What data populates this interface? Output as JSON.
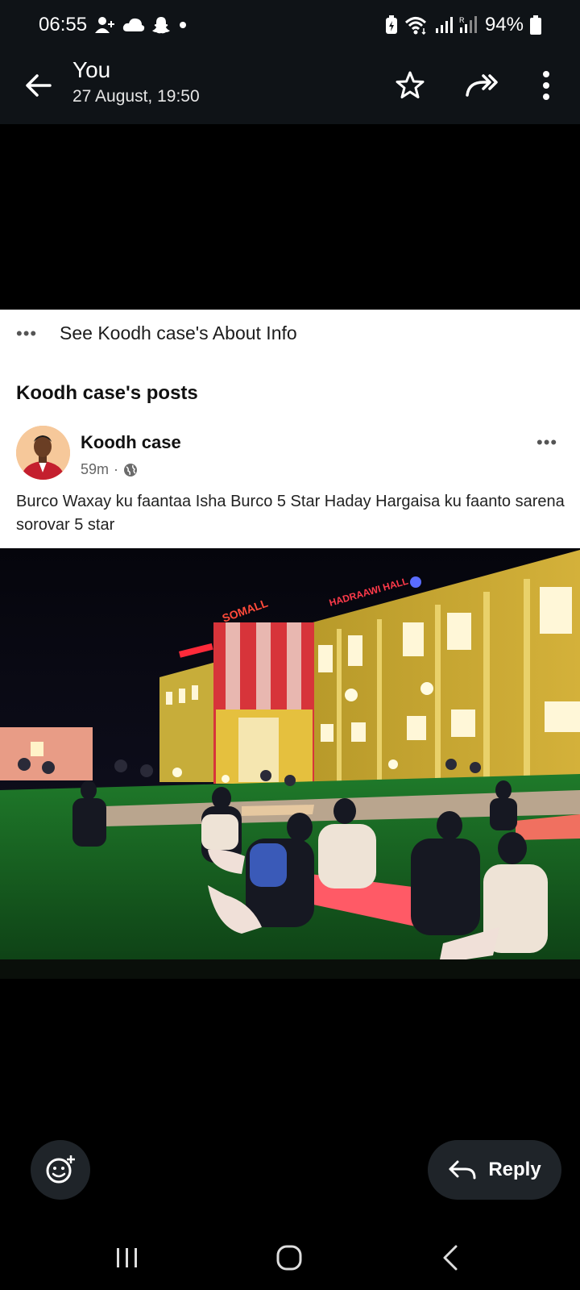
{
  "status_bar": {
    "time": "06:55",
    "battery": "94%",
    "icons": [
      "person-add-icon",
      "cloud-icon",
      "snapchat-icon",
      "dot-icon",
      "battery-saver-icon",
      "wifi-icon",
      "signal-icon",
      "signal-r-icon",
      "battery-icon"
    ]
  },
  "header": {
    "title": "You",
    "subtitle": "27 August, 19:50",
    "actions": [
      "star-icon",
      "forward-icon",
      "more-vertical-icon"
    ]
  },
  "post": {
    "about_link": "See Koodh case's About Info",
    "section_heading": "Koodh case's posts",
    "author": "Koodh case",
    "time_ago": "59m",
    "separator": "·",
    "privacy_icon": "globe-icon",
    "text": "Burco Waxay ku faantaa Isha Burco 5 Star  Haday Hargaisa ku faanto sarena sorovar 5 star",
    "image_signs": [
      "SOMALL",
      "HADRAAWI HALL"
    ]
  },
  "footer": {
    "reply_label": "Reply",
    "emoji_icon": "add-reaction-icon"
  },
  "navigation": [
    "recent-apps-icon",
    "home-icon",
    "back-icon"
  ],
  "colors": {
    "status_bg": "#0f1317",
    "button_bg": "#1f2429",
    "card_bg": "#ffffff"
  }
}
